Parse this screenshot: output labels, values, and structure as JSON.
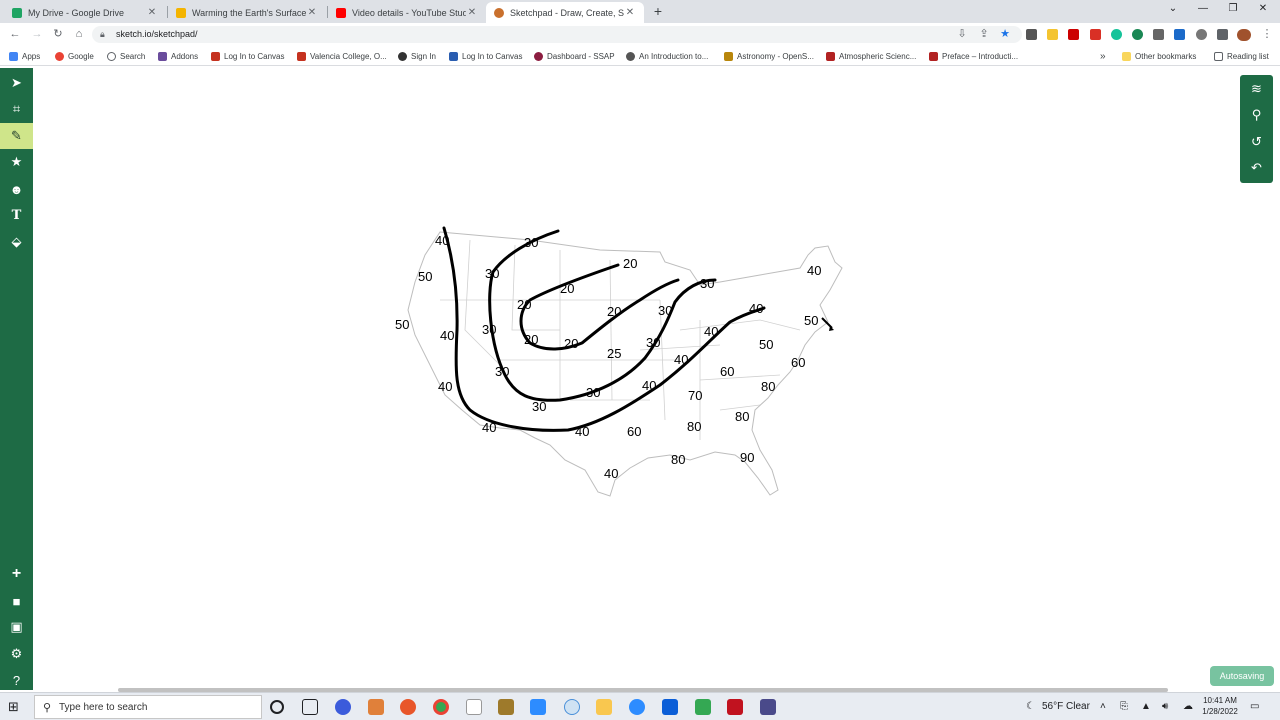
{
  "browser": {
    "tabs": [
      {
        "title": "My Drive - Google Drive",
        "favicon_color": "#1fa463"
      },
      {
        "title": "Warming the Earth's Surface and",
        "favicon_color": "#f4b400"
      },
      {
        "title": "Video details - YouTube Studio",
        "favicon_color": "#ff0000"
      },
      {
        "title": "Sketchpad - Draw, Create, Share!",
        "favicon_color": "#c9702d"
      }
    ],
    "active_tab": 3,
    "url": "sketch.io/sketchpad/",
    "bookmarks": [
      {
        "label": "Apps",
        "color": "#4285f4"
      },
      {
        "label": "Google",
        "color": "#ea4335"
      },
      {
        "label": "Search",
        "color": "#5f6368"
      },
      {
        "label": "Addons",
        "color": "#6a4c9c"
      },
      {
        "label": "Log In to Canvas",
        "color": "#c5321f"
      },
      {
        "label": "Valencia College, O...",
        "color": "#c5321f"
      },
      {
        "label": "Sign In",
        "color": "#333333"
      },
      {
        "label": "Log In to Canvas",
        "color": "#2a5db0"
      },
      {
        "label": "Dashboard - SSAP",
        "color": "#8c1d40"
      },
      {
        "label": "An Introduction to...",
        "color": "#555555"
      },
      {
        "label": "Astronomy - OpenS...",
        "color": "#b8860b"
      },
      {
        "label": "Atmospheric Scienc...",
        "color": "#b22222"
      },
      {
        "label": "Preface – Introducti...",
        "color": "#b22222"
      }
    ],
    "bookmarks_overflow": "»",
    "other_bookmarks": "Other bookmarks",
    "reading_list": "Reading list"
  },
  "sketchpad": {
    "autosave_label": "Autosaving"
  },
  "map": {
    "isolines": [
      {
        "label_positions": "west-40"
      },
      {
        "label_positions": "30"
      },
      {
        "label_positions": "20"
      },
      {
        "label_positions": "30"
      },
      {
        "label_positions": "40"
      }
    ],
    "values": [
      "40",
      "50",
      "50",
      "40",
      "40",
      "40",
      "30",
      "30",
      "30",
      "30",
      "30",
      "20",
      "20",
      "20",
      "20",
      "20",
      "20",
      "25",
      "30",
      "30",
      "30",
      "30",
      "40",
      "40",
      "40",
      "40",
      "40",
      "40",
      "40",
      "50",
      "50",
      "60",
      "60",
      "60",
      "70",
      "80",
      "80",
      "80",
      "80",
      "80",
      "90"
    ]
  },
  "taskbar": {
    "search_placeholder": "Type here to search",
    "weather": "56°F  Clear",
    "time": "10:41 AM",
    "date": "1/28/2022"
  }
}
